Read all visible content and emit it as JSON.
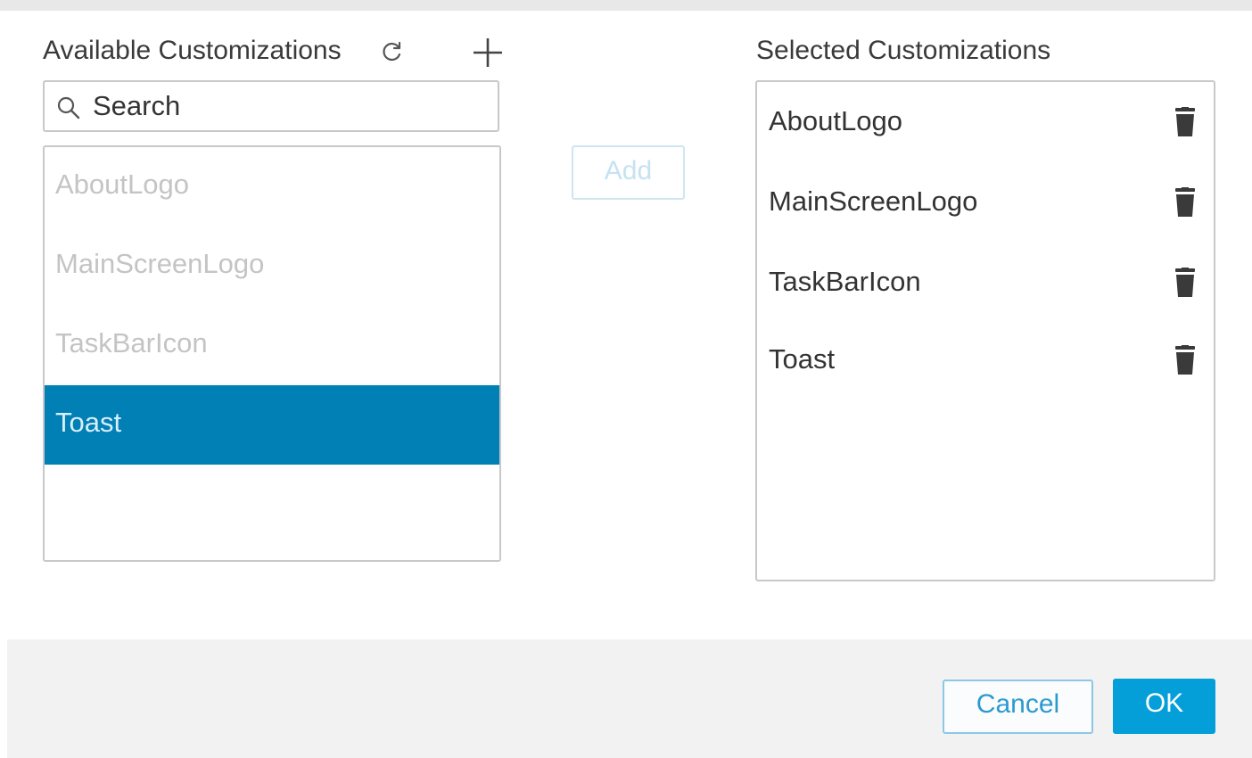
{
  "available": {
    "title": "Available Customizations",
    "refresh_icon": "refresh-icon",
    "add_icon": "plus-icon",
    "search": {
      "placeholder": "Search",
      "value": ""
    },
    "items": [
      {
        "label": "AboutLogo",
        "selected": false
      },
      {
        "label": "MainScreenLogo",
        "selected": false
      },
      {
        "label": "TaskBarIcon",
        "selected": false
      },
      {
        "label": "Toast",
        "selected": true
      }
    ]
  },
  "add_button": {
    "label": "Add",
    "enabled": false
  },
  "selected": {
    "title": "Selected Customizations",
    "items": [
      {
        "label": "AboutLogo",
        "icon": "trash-icon"
      },
      {
        "label": "MainScreenLogo",
        "icon": "trash-icon"
      },
      {
        "label": "TaskBarIcon",
        "icon": "trash-icon"
      },
      {
        "label": "Toast",
        "icon": "trash-icon"
      }
    ]
  },
  "footer": {
    "cancel_label": "Cancel",
    "ok_label": "OK"
  },
  "colors": {
    "selection_blue": "#0080b5",
    "primary_button": "#049fd9",
    "disabled_button_text": "#c5e2f1",
    "trash_icon": "#3a3a3a"
  }
}
